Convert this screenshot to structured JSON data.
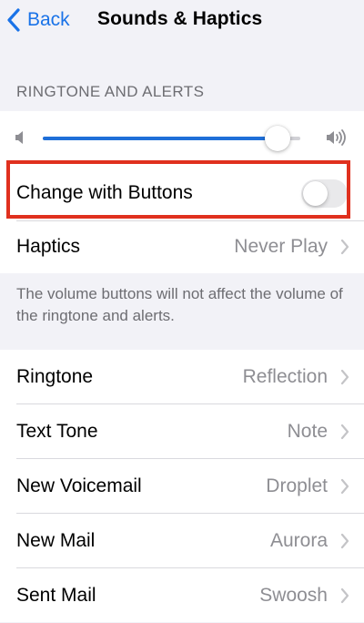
{
  "nav": {
    "back_label": "Back",
    "title": "Sounds & Haptics"
  },
  "section": {
    "header": "RINGTONE AND ALERTS"
  },
  "volume": {
    "level": 0.91
  },
  "change_with_buttons": {
    "label": "Change with Buttons",
    "enabled": false
  },
  "haptics": {
    "label": "Haptics",
    "value": "Never Play"
  },
  "footer": "The volume buttons will not affect the volume of the ringtone and alerts.",
  "sounds": [
    {
      "label": "Ringtone",
      "value": "Reflection"
    },
    {
      "label": "Text Tone",
      "value": "Note"
    },
    {
      "label": "New Voicemail",
      "value": "Droplet"
    },
    {
      "label": "New Mail",
      "value": "Aurora"
    },
    {
      "label": "Sent Mail",
      "value": "Swoosh"
    }
  ],
  "colors": {
    "accent": "#1f6fd8",
    "highlight": "#e0301e",
    "secondary_text": "#8e8e93"
  },
  "icons": {
    "back": "chevron-left-icon",
    "volume_low": "speaker-low-icon",
    "volume_high": "speaker-high-icon",
    "disclosure": "chevron-right-icon"
  }
}
